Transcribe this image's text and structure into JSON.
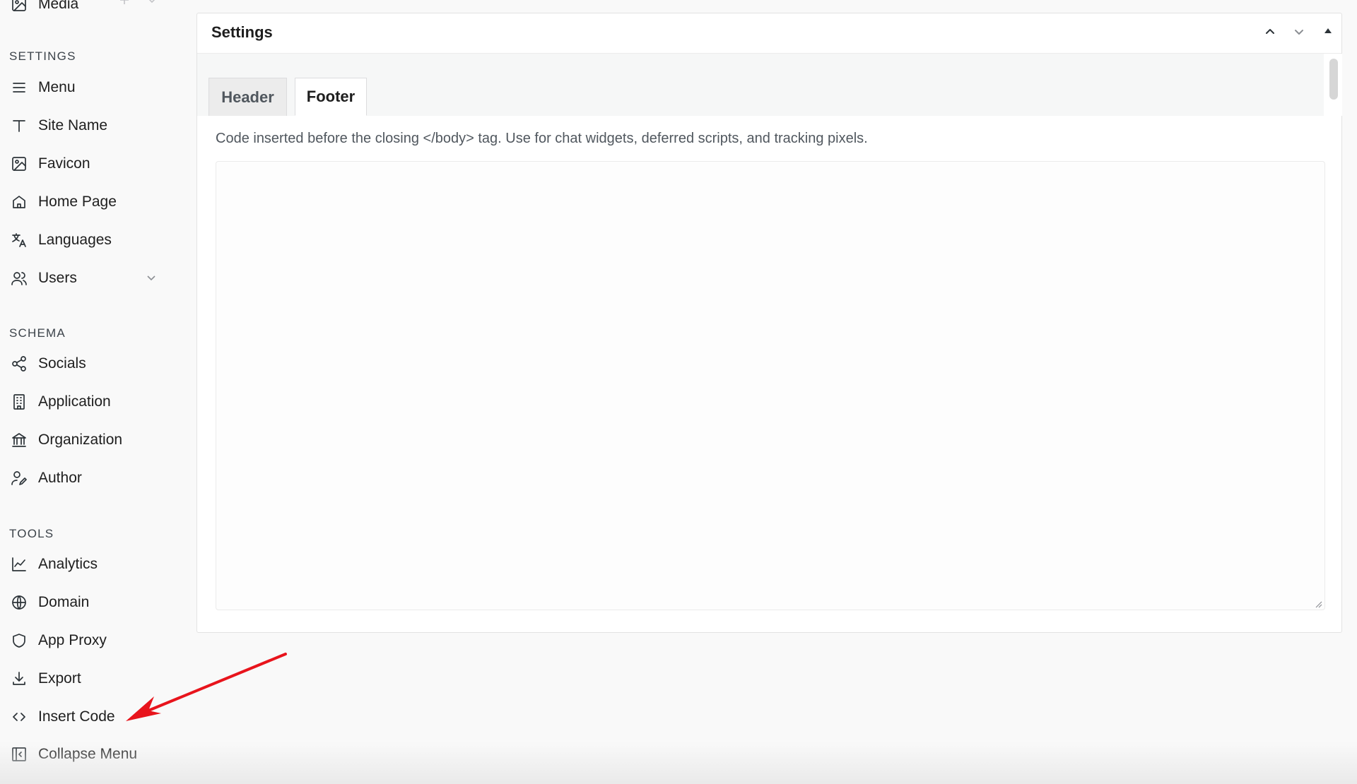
{
  "sidebar": {
    "top_item": {
      "label": "Media",
      "icon": "image-icon"
    },
    "sections": [
      {
        "title": "Settings",
        "items": [
          {
            "label": "Menu",
            "icon": "menu-icon"
          },
          {
            "label": "Site Name",
            "icon": "type-icon"
          },
          {
            "label": "Favicon",
            "icon": "image-icon"
          },
          {
            "label": "Home Page",
            "icon": "home-icon"
          },
          {
            "label": "Languages",
            "icon": "translate-icon"
          },
          {
            "label": "Users",
            "icon": "users-icon"
          }
        ]
      },
      {
        "title": "Schema",
        "items": [
          {
            "label": "Socials",
            "icon": "share-icon"
          },
          {
            "label": "Application",
            "icon": "building-icon"
          },
          {
            "label": "Organization",
            "icon": "institution-icon"
          },
          {
            "label": "Author",
            "icon": "user-pen-icon"
          }
        ]
      },
      {
        "title": "Tools",
        "items": [
          {
            "label": "Analytics",
            "icon": "chart-line-icon"
          },
          {
            "label": "Domain",
            "icon": "globe-icon"
          },
          {
            "label": "App Proxy",
            "icon": "shield-icon"
          },
          {
            "label": "Export",
            "icon": "download-icon"
          },
          {
            "label": "Insert Code",
            "icon": "code-icon"
          },
          {
            "label": "Collapse Menu",
            "icon": "collapse-icon"
          }
        ]
      }
    ]
  },
  "panel": {
    "title": "Settings",
    "tabs": [
      {
        "label": "Header",
        "active": false
      },
      {
        "label": "Footer",
        "active": true
      }
    ],
    "description": "Code inserted before the closing </body> tag. Use for chat widgets, deferred scripts, and tracking pixels.",
    "code_value": ""
  },
  "colors": {
    "annotation_arrow": "#e8141c",
    "background": "#f9f9f9"
  }
}
